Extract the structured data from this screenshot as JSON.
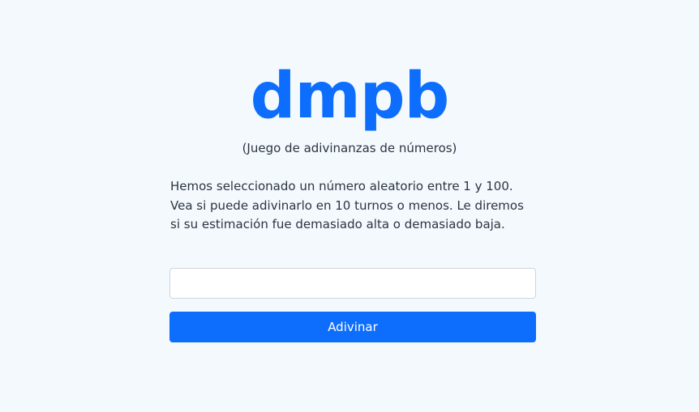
{
  "header": {
    "logo_text": "dmpb",
    "subtitle": "(Juego de adivinanzas de números)"
  },
  "intro": {
    "text": "Hemos seleccionado un número aleatorio entre 1 y 100. Vea si puede adivinarlo en 10 turnos o menos. Le diremos si su estimación fue demasiado alta o demasiado baja."
  },
  "form": {
    "guess_value": "",
    "guess_placeholder": "",
    "submit_label": "Adivinar"
  },
  "colors": {
    "accent": "#0d6efd",
    "background": "#f4f9fe",
    "text": "#2b3440"
  }
}
